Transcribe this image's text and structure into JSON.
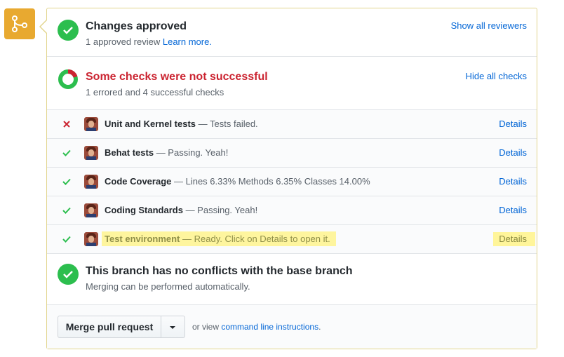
{
  "approved": {
    "title": "Changes approved",
    "subtitle_text": "1 approved review",
    "learn_more": "Learn more.",
    "show_reviewers": "Show all reviewers"
  },
  "checks_summary": {
    "title": "Some checks were not successful",
    "subtitle": "1 errored and 4 successful checks",
    "hide_checks": "Hide all checks",
    "errored": 1,
    "successful": 4
  },
  "checks": [
    {
      "status": "failed",
      "name": "Unit and Kernel tests",
      "desc": " — Tests failed.",
      "details": "Details"
    },
    {
      "status": "passed",
      "name": "Behat tests",
      "desc": " — Passing. Yeah!",
      "details": "Details"
    },
    {
      "status": "passed",
      "name": "Code Coverage",
      "desc": " — Lines 6.33% Methods 6.35% Classes 14.00%",
      "details": "Details"
    },
    {
      "status": "passed",
      "name": "Coding Standards",
      "desc": " — Passing. Yeah!",
      "details": "Details"
    },
    {
      "status": "passed",
      "name": "Test environment",
      "desc": " — Ready. Click on Details to open it.",
      "details": "Details"
    }
  ],
  "conflicts": {
    "title": "This branch has no conflicts with the base branch",
    "subtitle": "Merging can be performed automatically."
  },
  "merge": {
    "button_label": "Merge pull request",
    "hint_prefix": "or view ",
    "hint_link": "command line instructions",
    "hint_suffix": "."
  },
  "colors": {
    "success": "#2cbe4e",
    "error": "#cb2431",
    "link": "#0366d6",
    "merge_icon_bg": "#e8a930",
    "highlight": "#fff59a"
  }
}
